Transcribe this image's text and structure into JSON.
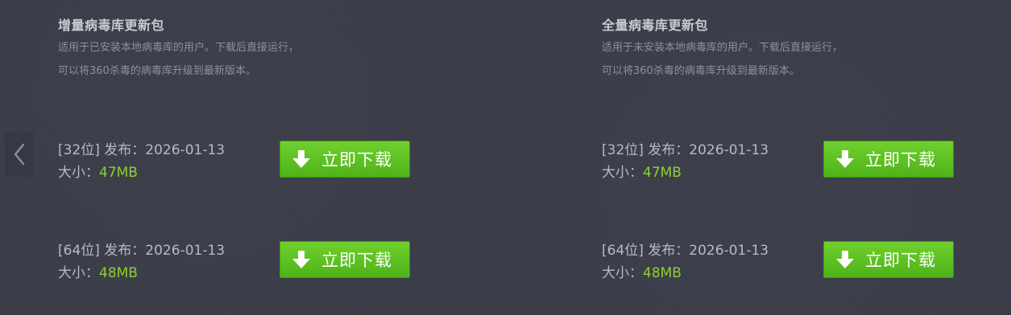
{
  "nav": {
    "prev_icon": "chevron-left-icon"
  },
  "panels": [
    {
      "title": "增量病毒库更新包",
      "desc_line1": "适用于已安装本地病毒库的用户。下载后直接运行，",
      "desc_line2": "可以将360杀毒的病毒库升级到最新版本。",
      "packages": [
        {
          "release": "[32位] 发布：2026-01-13",
          "size_label": "大小：",
          "size_value": "47MB",
          "button_label": "立即下载",
          "button_icon": "download-arrow-icon"
        },
        {
          "release": "[64位] 发布：2026-01-13",
          "size_label": "大小：",
          "size_value": "48MB",
          "button_label": "立即下载",
          "button_icon": "download-arrow-icon"
        }
      ]
    },
    {
      "title": "全量病毒库更新包",
      "desc_line1": "适用于未安装本地病毒库的用户。下载后直接运行，",
      "desc_line2": "可以将360杀毒的病毒库升级到最新版本。",
      "packages": [
        {
          "release": "[32位] 发布：2026-01-13",
          "size_label": "大小：",
          "size_value": "47MB",
          "button_label": "立即下载",
          "button_icon": "download-arrow-icon"
        },
        {
          "release": "[64位] 发布：2026-01-13",
          "size_label": "大小：",
          "size_value": "48MB",
          "button_label": "立即下载",
          "button_icon": "download-arrow-icon"
        }
      ]
    }
  ],
  "colors": {
    "background": "#3a3c48",
    "button_green": "#5cc024",
    "size_green": "#8ed12e",
    "title": "#c9cad2",
    "desc": "#8e909b"
  }
}
